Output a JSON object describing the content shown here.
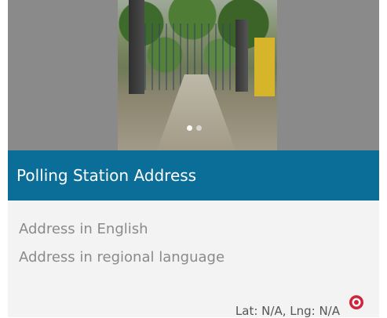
{
  "carousel": {
    "image": "polling-station-entrance-gate",
    "slides": 2,
    "active_slide": 1
  },
  "header": {
    "title": "Polling Station Address",
    "background": "#0b6e99"
  },
  "address": {
    "english": "Address in English",
    "regional": "Address in regional language"
  },
  "location": {
    "coords_text": "Lat: N/A, Lng: N/A",
    "pin_icon": "location-pin-icon",
    "pin_color": "#d3233a"
  }
}
